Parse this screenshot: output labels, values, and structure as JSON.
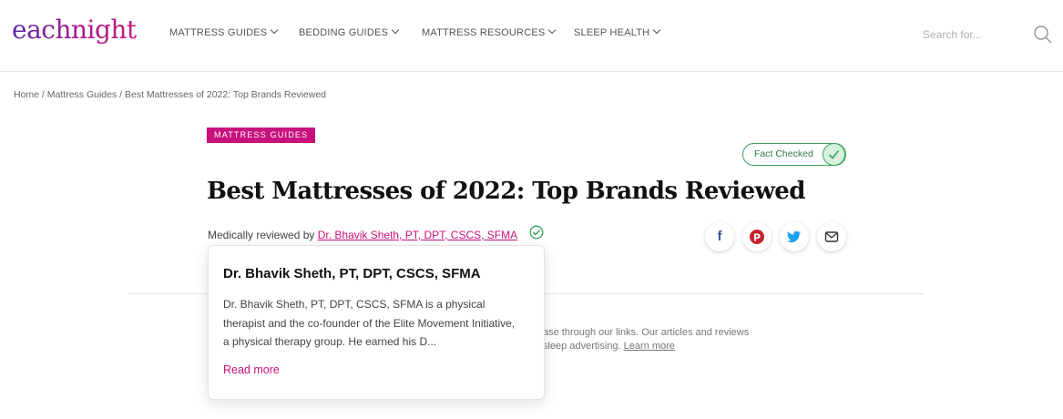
{
  "header": {
    "logo": "eachnight",
    "nav": [
      {
        "label": "MATTRESS GUIDES"
      },
      {
        "label": "BEDDING GUIDES"
      },
      {
        "label": "MATTRESS RESOURCES"
      },
      {
        "label": "SLEEP HEALTH"
      }
    ],
    "search_placeholder": "Search for..."
  },
  "breadcrumb": {
    "home": "Home",
    "sep": " / ",
    "section": "Mattress Guides",
    "current": "Best Mattresses of 2022: Top Brands Reviewed"
  },
  "article": {
    "category": "MATTRESS GUIDES",
    "fact_checked": "Fact Checked",
    "title": "Best Mattresses of 2022: Top Brands Reviewed",
    "reviewed_prefix": "Medically reviewed by ",
    "reviewer": "Dr. Bhavik Sheth, PT, DPT, CSCS, SFMA",
    "share": {
      "facebook": "f",
      "pinterest": "P",
      "twitter": "t",
      "email": "✉"
    },
    "disclosure_line1": "ase through our links. Our articles and reviews",
    "disclosure_line2": "sleep advertising. ",
    "disclosure_link": "Learn more"
  },
  "popover": {
    "name": "Dr. Bhavik Sheth, PT, DPT, CSCS, SFMA",
    "bio": "Dr. Bhavik Sheth, PT, DPT, CSCS, SFMA is a physical therapist and the co-founder of the Elite Movement Initiative, a physical therapy group. He earned his D...",
    "read_more": "Read more"
  },
  "colors": {
    "accent": "#c8127d",
    "fact": "#3aa55a",
    "facebook": "#3b5998",
    "pinterest": "#c8232c",
    "twitter": "#1da1f2"
  }
}
